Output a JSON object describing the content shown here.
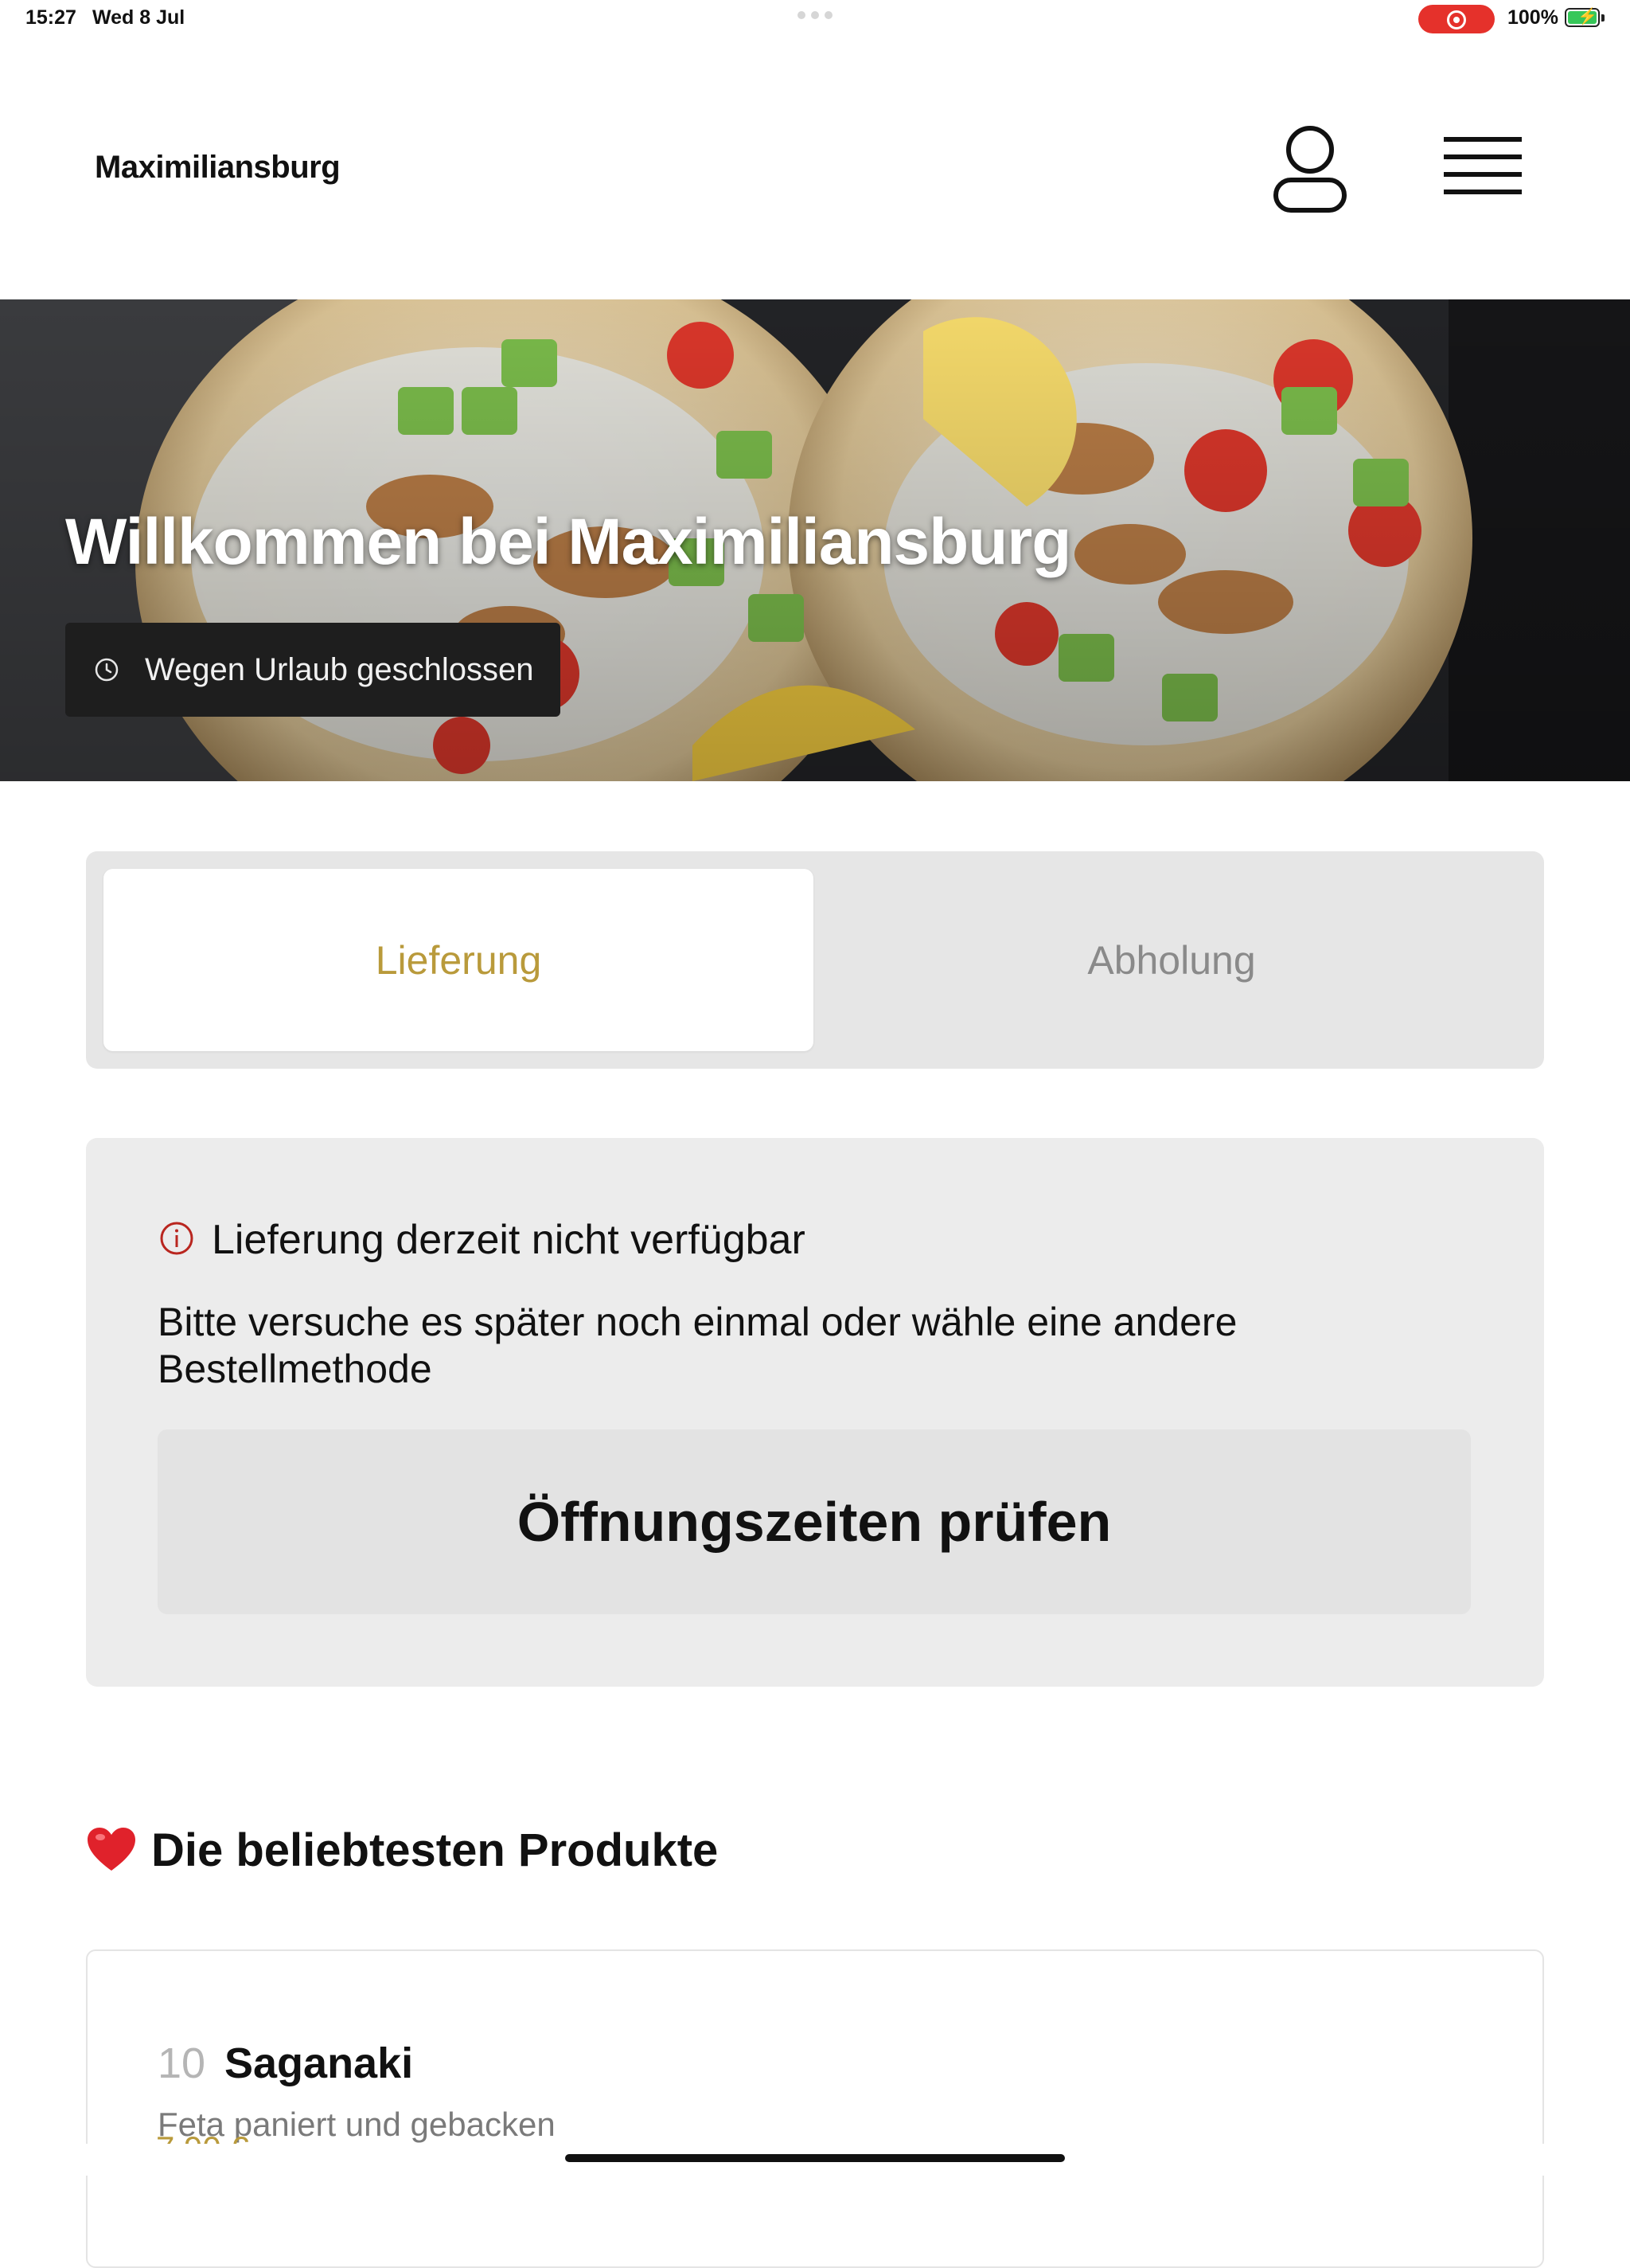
{
  "status_bar": {
    "time": "15:27",
    "date": "Wed 8 Jul",
    "battery": "100%",
    "recording_color": "#e5312b",
    "battery_color": "#36c759"
  },
  "header": {
    "brand": "Maximiliansburg",
    "account_icon": "user-icon",
    "menu_icon": "hamburger-menu-icon"
  },
  "hero": {
    "title": "Willkommen bei Maximiliansburg",
    "status": "Wegen Urlaub geschlossen",
    "status_icon": "clock-icon"
  },
  "order_method": {
    "tabs": [
      {
        "label": "Lieferung",
        "selected": true
      },
      {
        "label": "Abholung",
        "selected": false
      }
    ],
    "accent_color": "#b99a3b"
  },
  "notice": {
    "icon": "info-icon",
    "title": "Lieferung derzeit nicht verfügbar",
    "text": "Bitte versuche es später noch einmal oder wähle eine andere Bestellmethode",
    "button": "Öffnungszeiten prüfen"
  },
  "popular": {
    "icon": "heart-icon",
    "title": "Die beliebtesten Produkte",
    "items": [
      {
        "number": "10",
        "name": "Saganaki",
        "description": "Feta paniert und gebacken",
        "price": "7,90 €"
      }
    ]
  }
}
